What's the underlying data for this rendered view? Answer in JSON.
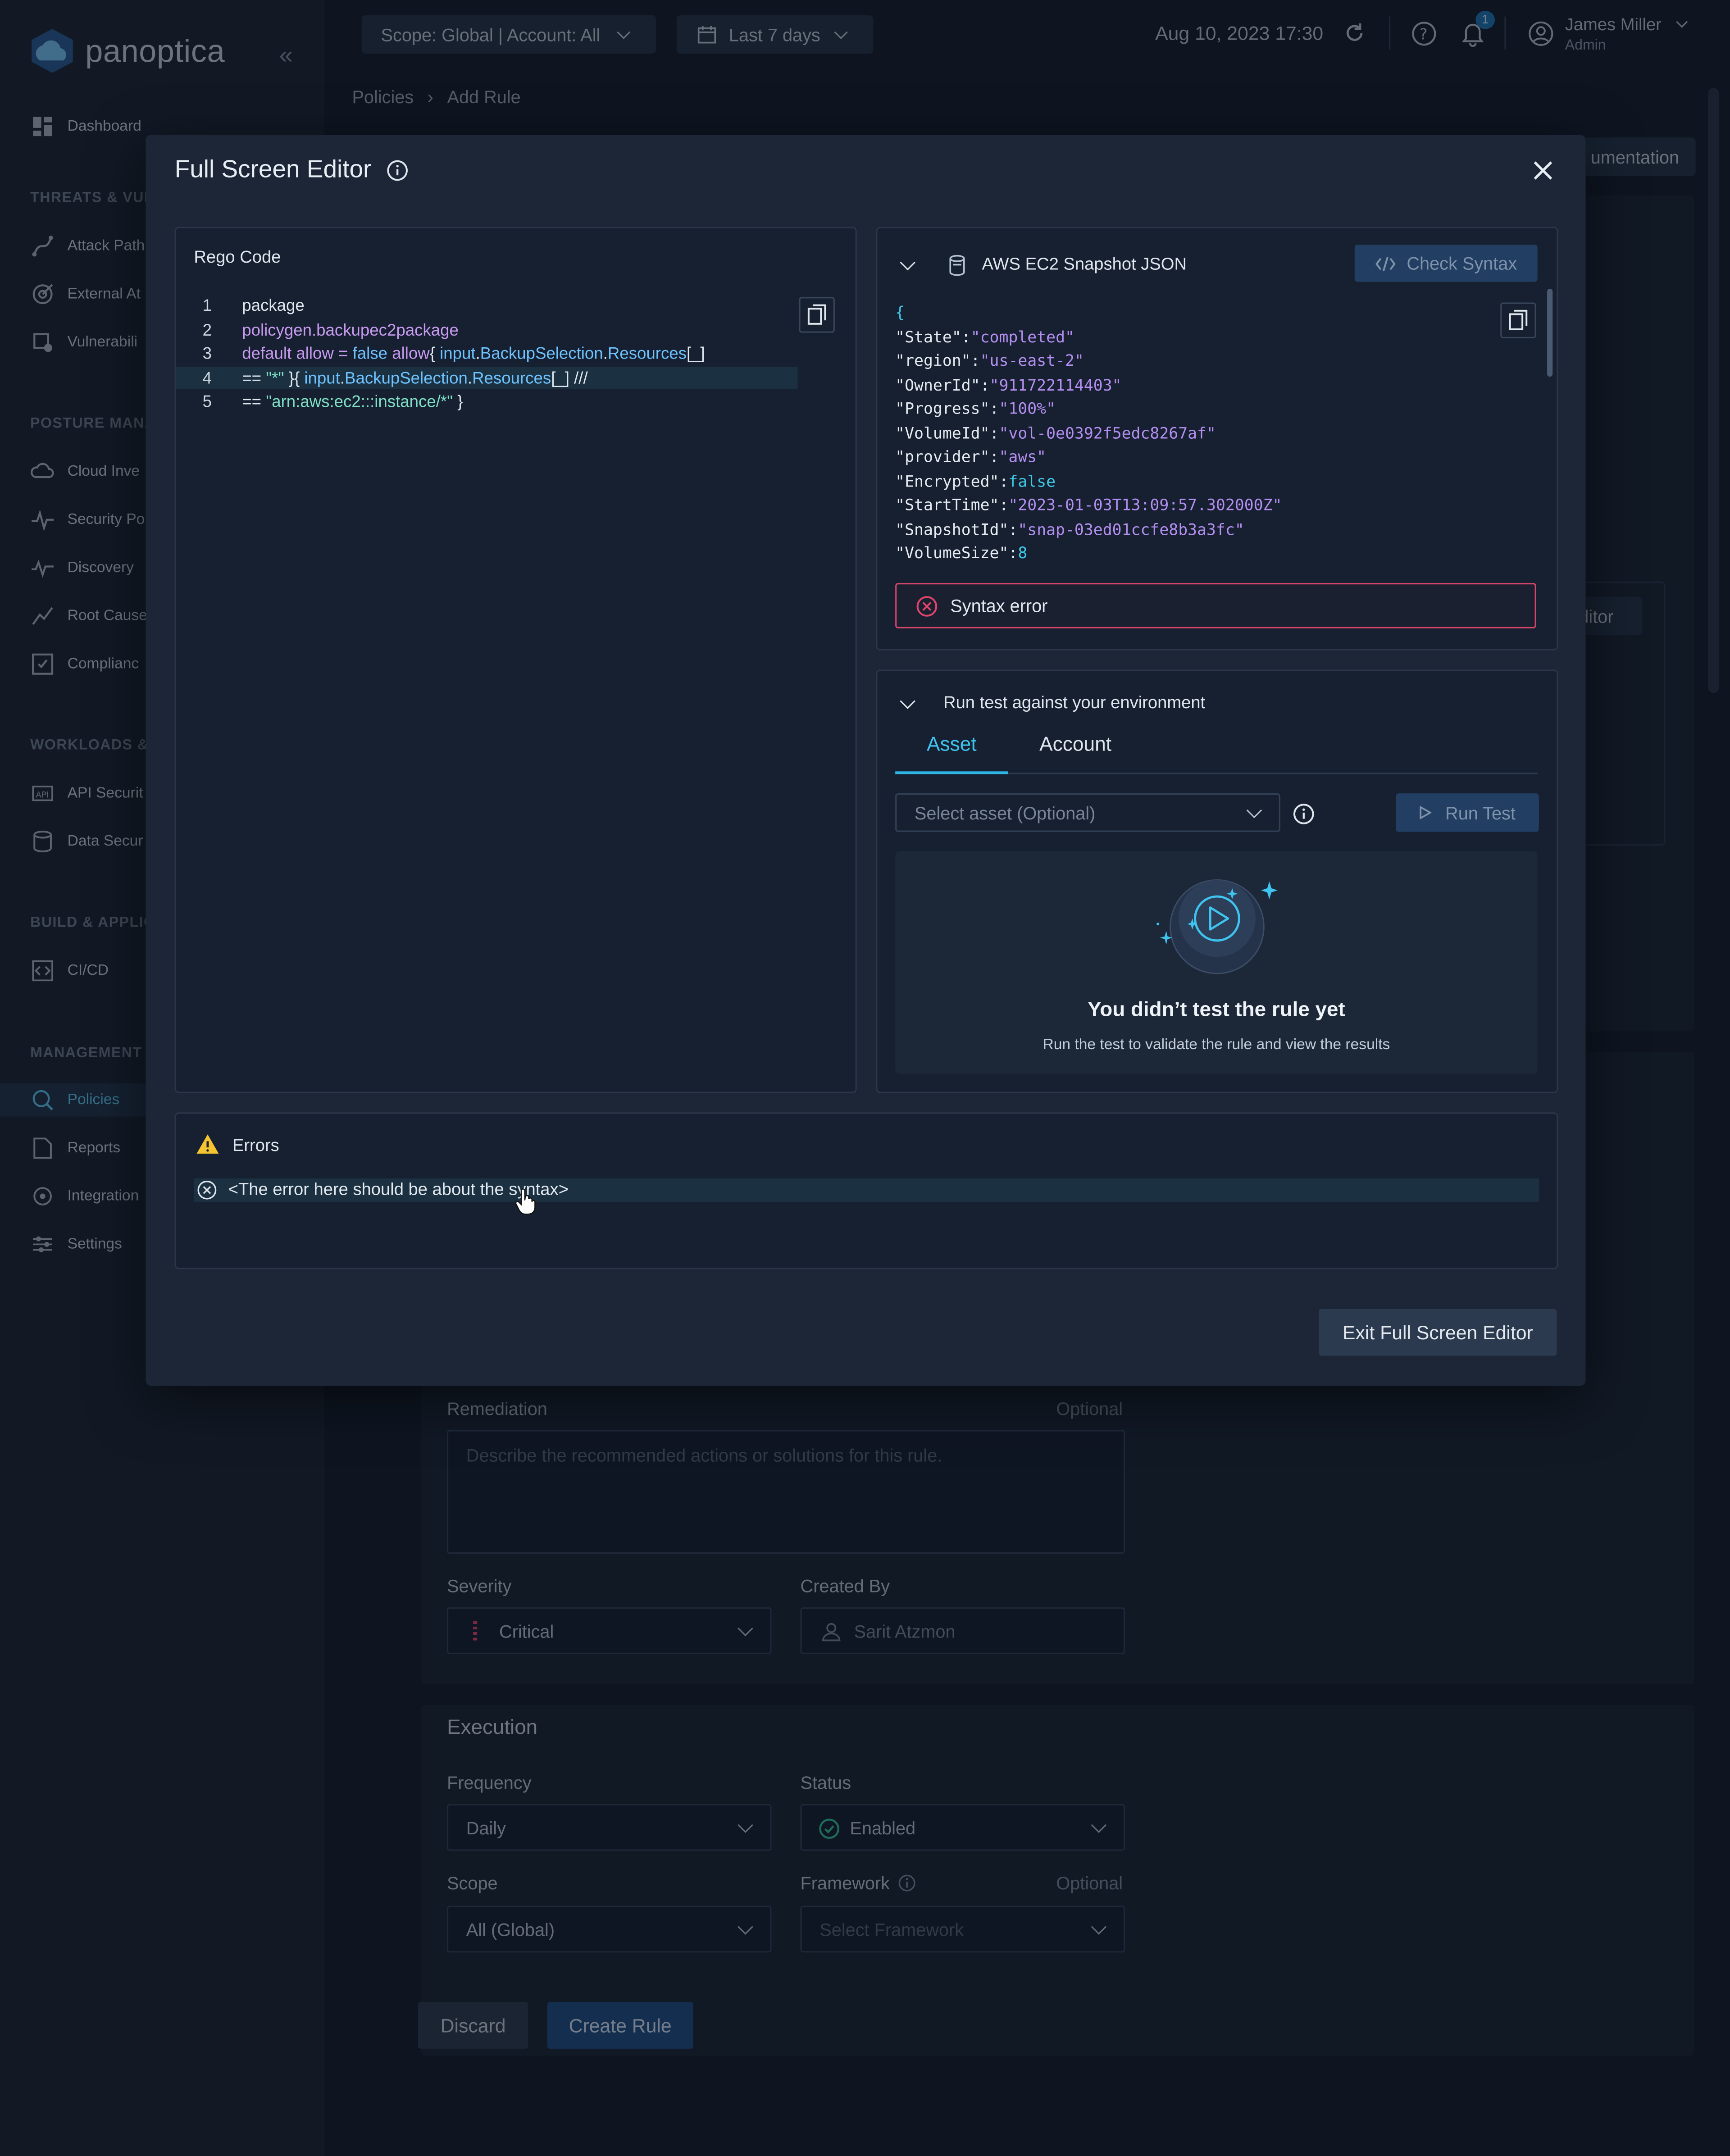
{
  "brand": {
    "name": "panoptica"
  },
  "sidebar": {
    "dashboard": "Dashboard",
    "sections": [
      "THREATS & VUL",
      "POSTURE MANA",
      "WORKLOADS &",
      "BUILD & APPLIC",
      "MANAGEMENT"
    ],
    "threats": [
      "Attack Path",
      "External At",
      "Vulnerabili"
    ],
    "posture": [
      "Cloud Inve",
      "Security Po",
      "Discovery",
      "Root Cause",
      "Complianc"
    ],
    "workloads": [
      "API Securit",
      "Data Secur"
    ],
    "build": [
      "CI/CD"
    ],
    "management": [
      "Policies",
      "Reports",
      "Integration",
      "Settings"
    ]
  },
  "topbar": {
    "scope": "Scope: Global | Account: All",
    "range": "Last 7 days",
    "datetime": "Aug 10, 2023 17:30",
    "notif_count": "1",
    "user_name": "James Miller",
    "user_role": "Admin"
  },
  "breadcrumb": {
    "root": "Policies",
    "current": "Add Rule"
  },
  "bg": {
    "doc_btn": "umentation",
    "editor_btn": "ditor",
    "remediation_label": "Remediation",
    "remediation_optional": "Optional",
    "remediation_placeholder": "Describe the recommended actions or solutions for this rule.",
    "severity_label": "Severity",
    "severity_value": "Critical",
    "created_label": "Created By",
    "created_value": "Sarit Atzmon",
    "execution_title": "Execution",
    "frequency_label": "Frequency",
    "frequency_value": "Daily",
    "status_label": "Status",
    "status_value": "Enabled",
    "scope_label": "Scope",
    "scope_value": "All (Global)",
    "framework_label": "Framework",
    "framework_optional": "Optional",
    "framework_placeholder": "Select Framework",
    "discard": "Discard",
    "create": "Create Rule",
    "severity_color": "#e0456b",
    "status_color": "#37c39a"
  },
  "modal": {
    "title": "Full Screen Editor",
    "code_title": "Rego Code",
    "code_lines": [
      {
        "n": "1",
        "parts": [
          {
            "t": "package",
            "c": "#dfe6ee"
          }
        ]
      },
      {
        "n": "2",
        "parts": [
          {
            "t": "policygen.backupec2package",
            "c": "#c89bf0"
          }
        ]
      },
      {
        "n": "3",
        "parts": [
          {
            "t": "default allow = ",
            "c": "#c89bf0"
          },
          {
            "t": "false",
            "c": "#6ec3ff"
          },
          {
            "t": " allow",
            "c": "#c89bf0"
          },
          {
            "t": "{ ",
            "c": "#dfe6ee"
          },
          {
            "t": "input",
            "c": "#6ec3ff"
          },
          {
            "t": ".",
            "c": "#dfe6ee"
          },
          {
            "t": "BackupSelection",
            "c": "#6ec3ff"
          },
          {
            "t": ".",
            "c": "#dfe6ee"
          },
          {
            "t": "Resources",
            "c": "#6ec3ff"
          },
          {
            "t": "[_]",
            "c": "#dfe6ee"
          }
        ]
      },
      {
        "n": "4",
        "parts": [
          {
            "t": "== ",
            "c": "#dfe6ee"
          },
          {
            "t": "\"*\"",
            "c": "#7fe0c6"
          },
          {
            "t": " }{ ",
            "c": "#dfe6ee"
          },
          {
            "t": "input",
            "c": "#6ec3ff"
          },
          {
            "t": ".",
            "c": "#dfe6ee"
          },
          {
            "t": "BackupSelection",
            "c": "#6ec3ff"
          },
          {
            "t": ".",
            "c": "#dfe6ee"
          },
          {
            "t": "Resources",
            "c": "#6ec3ff"
          },
          {
            "t": "[_] ///",
            "c": "#dfe6ee"
          }
        ]
      },
      {
        "n": "5",
        "parts": [
          {
            "t": "== ",
            "c": "#dfe6ee"
          },
          {
            "t": "\"arn:aws:ec2:::instance/*\"",
            "c": "#7fe0c6"
          },
          {
            "t": " }",
            "c": "#dfe6ee"
          }
        ]
      }
    ],
    "json_title": "AWS EC2 Snapshot JSON",
    "check_syntax": "Check Syntax",
    "json_open": "{",
    "json_lines": [
      {
        "k": "\"State\"",
        "v": "\"completed\"",
        "vc": "#b48ef0"
      },
      {
        "k": "\"region\"",
        "v": "\"us-east-2\"",
        "vc": "#b48ef0"
      },
      {
        "k": "\"OwnerId\"",
        "v": "\"911722114403\"",
        "vc": "#b48ef0"
      },
      {
        "k": "\"Progress\"",
        "v": "\"100%\"",
        "vc": "#b48ef0"
      },
      {
        "k": "\"VolumeId\"",
        "v": "\"vol-0e0392f5edc8267af\"",
        "vc": "#b48ef0"
      },
      {
        "k": "\"provider\"",
        "v": "\"aws\"",
        "vc": "#b48ef0"
      },
      {
        "k": "\"Encrypted\"",
        "v": "false",
        "vc": "#3fc8e6"
      },
      {
        "k": "\"StartTime\"",
        "v": "\"2023-01-03T13:09:57.302000Z\"",
        "vc": "#b48ef0"
      },
      {
        "k": "\"SnapshotId\"",
        "v": "\"snap-03ed01ccfe8b3a3fc\"",
        "vc": "#b48ef0"
      },
      {
        "k": "\"VolumeSize\"",
        "v": "8",
        "vc": "#3fc8e6"
      }
    ],
    "syntax_error": "Syntax error",
    "run_test_title": "Run test against your environment",
    "tabs": [
      "Asset",
      "Account"
    ],
    "select_asset_placeholder": "Select asset (Optional)",
    "run_test": "Run Test",
    "empty_title": "You didn’t test the rule yet",
    "empty_sub": "Run the test to validate the rule and view the results",
    "errors_title": "Errors",
    "error_message": "<The error here should be about the syntax>",
    "exit": "Exit Full Screen Editor"
  },
  "colors": {
    "accent": "#2fb7e8",
    "primary_button": "#1f4d86",
    "error": "#e0456b",
    "warning": "#f5c531"
  }
}
